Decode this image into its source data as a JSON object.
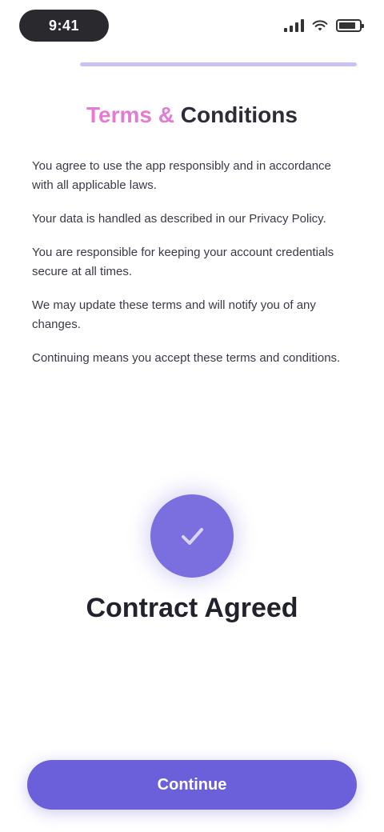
{
  "status_bar": {
    "time": "9:41",
    "icons": [
      "signal-icon",
      "wifi-icon",
      "battery-icon"
    ]
  },
  "progress": {
    "value": 1.0
  },
  "title": {
    "accent": "Terms &",
    "rest": " Conditions"
  },
  "bullets": [
    "You agree to use the app responsibly and in accordance with all applicable laws.",
    "Your data is handled as described in our Privacy Policy.",
    "You are responsible for keeping your account credentials secure at all times.",
    "We may update these terms and will notify you of any changes.",
    "Continuing means you accept these terms and conditions."
  ],
  "agreement": {
    "label": "Contract Agreed",
    "icon": "check-icon"
  },
  "button": {
    "label": "Continue"
  },
  "colors": {
    "accent": "#6c60da",
    "badge": "#7b6fdf",
    "title_accent": "#e37bd0",
    "progress_track": "#e7e4fb"
  }
}
